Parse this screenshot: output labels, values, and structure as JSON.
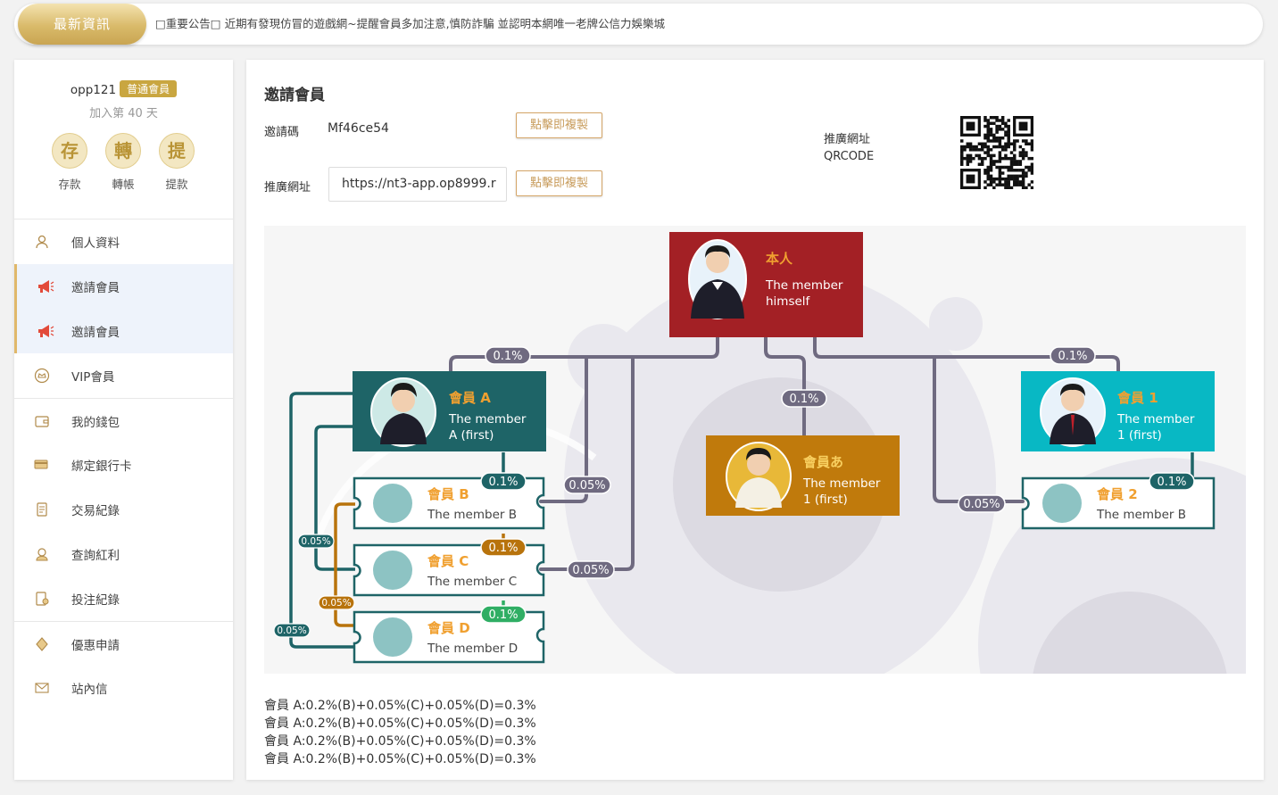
{
  "news": {
    "tag": "最新資訊",
    "text": "□重要公告□  近期有發現仿冒的遊戲網~提醒會員多加注意,慎防詐騙 並認明本網唯一老牌公信力娛樂城"
  },
  "user": {
    "name": "opp121",
    "level": "普通會員",
    "join_days": "加入第 40 天"
  },
  "quick_actions": [
    {
      "glyph": "存",
      "label": "存款"
    },
    {
      "glyph": "轉",
      "label": "轉帳"
    },
    {
      "glyph": "提",
      "label": "提款"
    }
  ],
  "menu": [
    {
      "label": "個人資料",
      "icon": "user-icon"
    },
    {
      "label": "邀請會員",
      "icon": "megaphone-icon"
    },
    {
      "label": "邀請會員",
      "icon": "megaphone-icon"
    },
    {
      "label": "VIP會員",
      "icon": "crown-icon"
    },
    {
      "label": "我的錢包",
      "icon": "wallet-icon"
    },
    {
      "label": "綁定銀行卡",
      "icon": "card-icon"
    },
    {
      "label": "交易紀錄",
      "icon": "receipt-icon"
    },
    {
      "label": "查詢紅利",
      "icon": "bonus-icon"
    },
    {
      "label": "投注紀錄",
      "icon": "bet-icon"
    },
    {
      "label": "優惠申請",
      "icon": "offer-icon"
    },
    {
      "label": "站內信",
      "icon": "mail-icon"
    }
  ],
  "main": {
    "title": "邀請會員",
    "code_label": "邀請碼",
    "code_value": "Mf46ce54",
    "copy_label": "點擊即複製",
    "url_label": "推廣網址",
    "url_value": "https://nt3-app.op8999.r",
    "qr_label_1": "推廣網址",
    "qr_label_2": "QRCODE"
  },
  "diagram": {
    "self": {
      "title": "本人",
      "line1": "The member",
      "line2": "himself"
    },
    "a": {
      "title": "會員 A",
      "line1": "The member",
      "line2": "A (first)"
    },
    "hira": {
      "title": "會員あ",
      "line1": "The member",
      "line2": "1 (first)"
    },
    "one": {
      "title": "會員 1",
      "line1": "The member",
      "line2": "1 (first)"
    },
    "b": {
      "title": "會員 B",
      "line1": "The member B"
    },
    "c": {
      "title": "會員 C",
      "line1": "The member C"
    },
    "d": {
      "title": "會員 D",
      "line1": "The member D"
    },
    "two": {
      "title": "會員 2",
      "line1": "The member B"
    },
    "rates": {
      "r01": "0.1%",
      "r005": "0.05%"
    }
  },
  "formulas": [
    "會員 A:0.2%(B)+0.05%(C)+0.05%(D)=0.3%",
    "會員 A:0.2%(B)+0.05%(C)+0.05%(D)=0.3%",
    "會員 A:0.2%(B)+0.05%(C)+0.05%(D)=0.3%",
    "會員 A:0.2%(B)+0.05%(C)+0.05%(D)=0.3%"
  ],
  "colors": {
    "gold": "#c9a640",
    "self_red": "#a32025",
    "member_a_teal": "#1e6467",
    "member_hira_orange": "#c07a0c",
    "member_one_cyan": "#08b8c4",
    "line_gray": "#6f6a80",
    "title_orange": "#f0a030"
  }
}
